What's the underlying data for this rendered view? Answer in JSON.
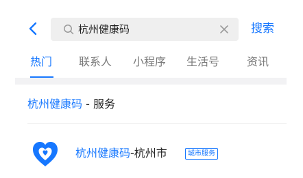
{
  "search": {
    "query": "杭州健康码",
    "submit_label": "搜索"
  },
  "tabs": [
    {
      "label": "热门",
      "active": true
    },
    {
      "label": "联系人",
      "active": false
    },
    {
      "label": "小程序",
      "active": false
    },
    {
      "label": "生活号",
      "active": false
    },
    {
      "label": "资讯",
      "active": false
    }
  ],
  "section": {
    "highlight": "杭州健康码",
    "suffix": " - 服务"
  },
  "result": {
    "title_highlight": "杭州健康码",
    "title_suffix": "-杭州市",
    "badge": "城市服务",
    "icon": "health-code-app-icon"
  },
  "colors": {
    "accent": "#1677ff",
    "search_bg": "#efefef",
    "inactive_tab": "#7a7a7a"
  },
  "icons": {
    "back": "chevron-left-icon",
    "search": "search-icon",
    "clear": "close-icon"
  }
}
